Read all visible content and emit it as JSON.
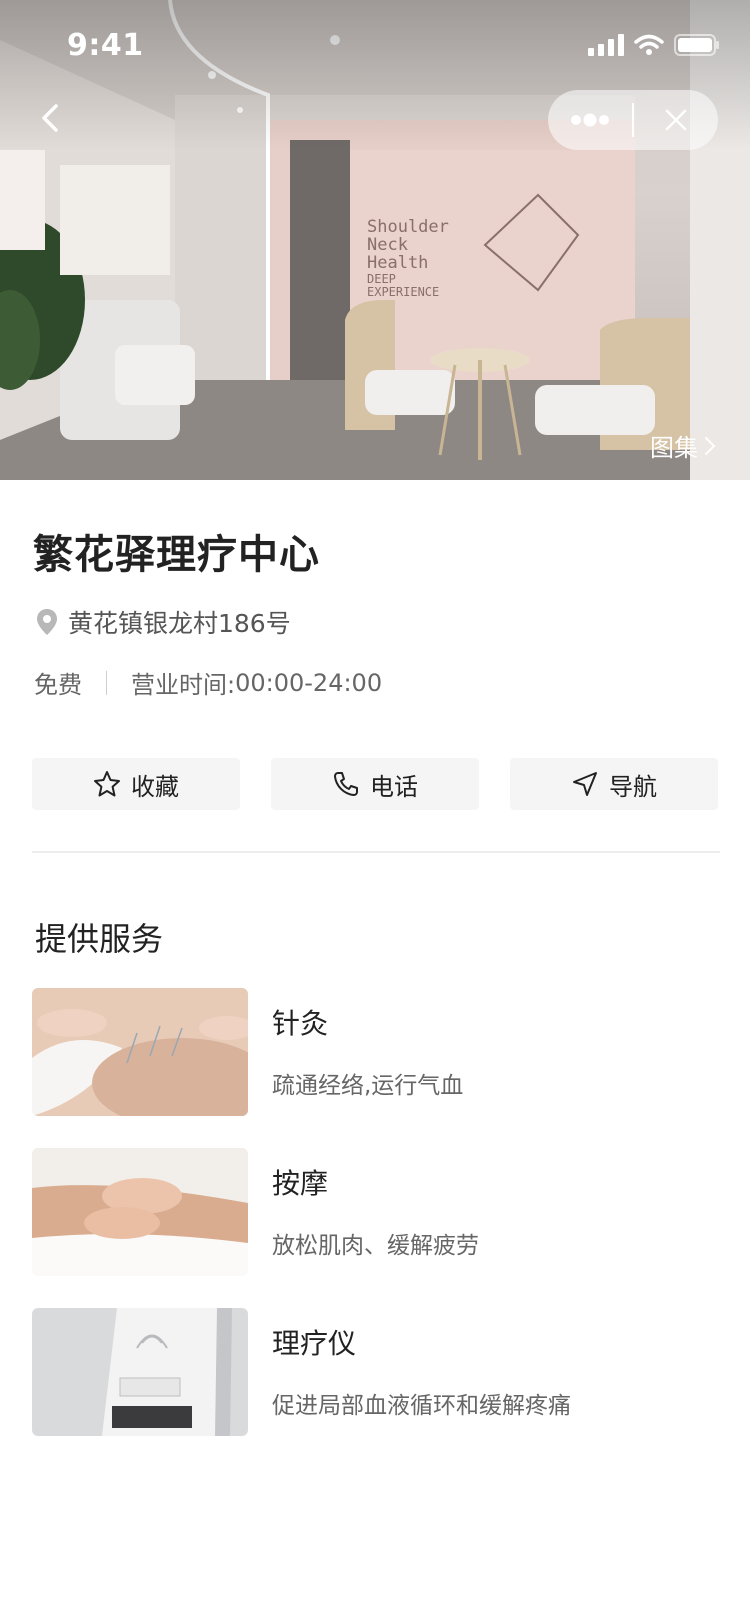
{
  "status_bar": {
    "time": "9:41",
    "icons": [
      "signal-icon",
      "wifi-icon",
      "battery-icon"
    ]
  },
  "nav": {
    "back_icon": "chevron-left-icon",
    "more_icon": "more-dots-icon",
    "close_icon": "close-icon"
  },
  "hero": {
    "gallery_label": "图集"
  },
  "place": {
    "name": "繁花驿理疗中心",
    "address": "黄花镇银龙村186号",
    "price": "免费",
    "hours_label": "营业时间:",
    "hours_value": "00:00-24:00"
  },
  "actions": [
    {
      "label": "收藏",
      "icon": "star-icon"
    },
    {
      "label": "电话",
      "icon": "phone-icon"
    },
    {
      "label": "导航",
      "icon": "navigation-arrow-icon"
    }
  ],
  "services_section": {
    "title": "提供服务",
    "items": [
      {
        "name": "针灸",
        "desc": "疏通经络,运行气血"
      },
      {
        "name": "按摩",
        "desc": "放松肌肉、缓解疲劳"
      },
      {
        "name": "理疗仪",
        "desc": "促进局部血液循环和缓解疼痛"
      }
    ]
  },
  "colors": {
    "text_primary": "#222222",
    "text_secondary": "#666666",
    "button_bg": "#f5f5f5",
    "divider": "#ececec"
  }
}
